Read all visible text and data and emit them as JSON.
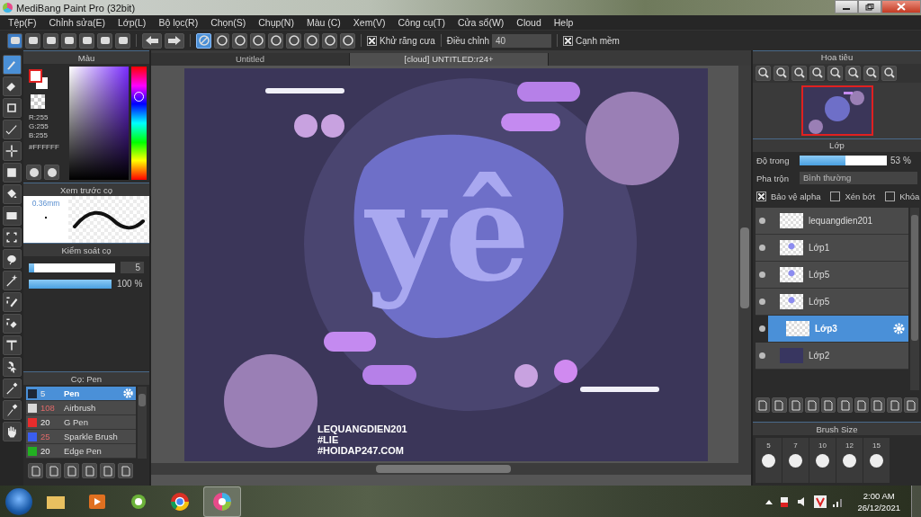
{
  "window": {
    "title": "MediBang Paint Pro (32bit)"
  },
  "menu": [
    "Tệp(F)",
    "Chỉnh sửa(E)",
    "Lớp(L)",
    "Bộ lọc(R)",
    "Chọn(S)",
    "Chụp(N)",
    "Màu (C)",
    "Xem(V)",
    "Công cụ(T)",
    "Cửa sổ(W)",
    "Cloud",
    "Help"
  ],
  "toolbar": {
    "snap": [
      {
        "selected": true
      },
      {
        "selected": false
      },
      {
        "selected": false
      },
      {
        "selected": false
      },
      {
        "selected": false
      },
      {
        "selected": false
      },
      {
        "selected": false
      },
      {
        "selected": false
      },
      {
        "selected": false
      }
    ],
    "antialias": {
      "label": "Khử răng cưa",
      "checked": true
    },
    "adjust": {
      "label": "Điều chỉnh",
      "value": "40"
    },
    "soft_edge": {
      "label": "Cạnh mềm",
      "checked": true
    }
  },
  "tools": [
    {
      "selected": true
    },
    {
      "selected": false
    },
    {
      "selected": false
    },
    {
      "selected": false
    },
    {
      "selected": false
    },
    {
      "selected": false
    },
    {
      "selected": false
    },
    {
      "selected": false
    },
    {
      "selected": false
    },
    {
      "selected": false
    },
    {
      "selected": false
    },
    {
      "selected": false
    },
    {
      "selected": false
    },
    {
      "selected": false
    },
    {
      "selected": false
    },
    {
      "selected": false
    },
    {
      "selected": false
    },
    {
      "selected": false
    }
  ],
  "color_panel": {
    "title": "Màu",
    "r": "R:255",
    "g": "G:255",
    "b": "B:255",
    "hex": "#FFFFFF",
    "hue": {
      "level": 0.74
    }
  },
  "brush_preview": {
    "title": "Xem trước cọ",
    "size": "0.36mm"
  },
  "brush_control": {
    "title": "Kiểm soát cọ",
    "size": {
      "level": 0.06,
      "value": "5"
    },
    "opacity": {
      "level": 1,
      "value": "100 %"
    }
  },
  "brush_list": {
    "title": "Cọ: Pen",
    "items": [
      {
        "size": "5",
        "name": "Pen",
        "color": "#1e2838",
        "selected": true,
        "flagged": false
      },
      {
        "size": "108",
        "name": "Airbrush",
        "color": "#d8d8d8",
        "selected": false,
        "flagged": true
      },
      {
        "size": "20",
        "name": "G Pen",
        "color": "#e82c2c",
        "selected": false,
        "flagged": false
      },
      {
        "size": "25",
        "name": "Sparkle Brush",
        "color": "#3a5ef0",
        "selected": false,
        "flagged": true
      },
      {
        "size": "20",
        "name": "Edge Pen",
        "color": "#22b022",
        "selected": false,
        "flagged": false
      }
    ]
  },
  "canvas": {
    "tabs": [
      {
        "label": "Untitled",
        "selected": false
      },
      {
        "label": "[cloud] UNTITLED:r24+",
        "selected": true
      }
    ],
    "lettering": "yê",
    "signature": [
      "LEQUANGDIEN201",
      "#LIE",
      "#HOIDAP247.COM"
    ]
  },
  "navigator": {
    "title": "Hoa tiêu"
  },
  "layers": {
    "title": "Lớp",
    "opacity": {
      "label": "Độ trong",
      "level": 0.53,
      "value": "53 %"
    },
    "blend": {
      "label": "Pha trộn",
      "value": "Bình thường"
    },
    "options": [
      {
        "label": "Bảo vệ alpha",
        "checked": true
      },
      {
        "label": "Xén bớt",
        "checked": false
      },
      {
        "label": "Khóa",
        "checked": false
      }
    ],
    "items": [
      {
        "name": "lequangdien201",
        "kind": "blank",
        "selected": false
      },
      {
        "name": "Lớp1",
        "kind": "sketch",
        "selected": false
      },
      {
        "name": "Lớp5",
        "kind": "sketch",
        "selected": false
      },
      {
        "name": "Lớp5",
        "kind": "sketch",
        "selected": false
      },
      {
        "name": "Lớp3",
        "kind": "blank",
        "selected": true
      },
      {
        "name": "Lớp2",
        "kind": "dark",
        "selected": false
      }
    ]
  },
  "brush_size": {
    "title": "Brush Size",
    "sizes": [
      "5",
      "7",
      "10",
      "12",
      "15"
    ]
  },
  "taskbar": {
    "time": "2:00 AM",
    "date": "26/12/2021"
  }
}
